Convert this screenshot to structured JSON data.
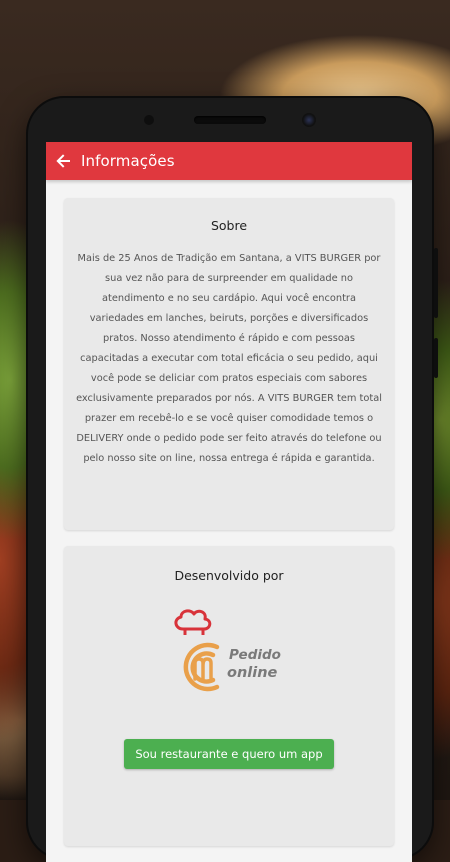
{
  "appbar": {
    "title": "Informações"
  },
  "about": {
    "title": "Sobre",
    "text": "Mais de 25 Anos de Tradição em Santana, a VITS BURGER por sua vez não para de surpreender em qualidade no atendimento e no seu cardápio. Aqui você encontra variedades em lanches, beiruts, porções e diversificados pratos. Nosso atendimento é rápido e com pessoas capacitadas a executar com total eficácia o seu pedido, aqui você pode se deliciar com pratos especiais com sabores exclusivamente preparados por nós. A VITS BURGER tem total prazer em recebê-lo e se você quiser comodidade temos o DELIVERY onde o pedido pode ser feito através do telefone ou pelo nosso site on line, nossa entrega é rápida e garantida."
  },
  "developer": {
    "title": "Desenvolvido por",
    "logo_text_line1": "Pedido",
    "logo_text_line2": "online",
    "button_label": "Sou restaurante e quero um app"
  },
  "colors": {
    "appbar": "#e0383e",
    "button": "#4caf50",
    "logo_orange": "#e9a04a",
    "logo_red": "#d8333a",
    "logo_gray": "#7a7a7a"
  },
  "icons": {
    "back": "arrow-left-icon",
    "logo": "chef-hat-icon"
  }
}
